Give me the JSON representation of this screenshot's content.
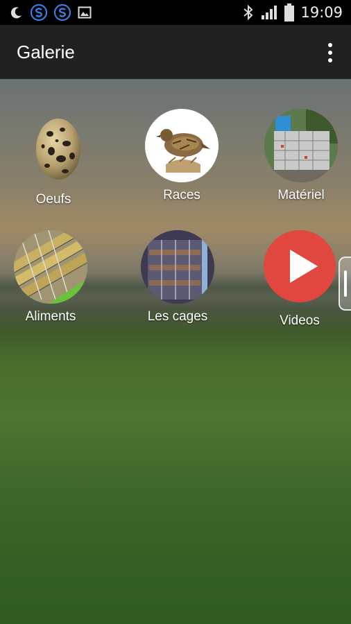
{
  "status_bar": {
    "time": "19:09",
    "icons": [
      "moon-icon",
      "s-app-icon",
      "s-app-icon",
      "image-icon",
      "bluetooth-icon",
      "signal-icon",
      "battery-icon"
    ]
  },
  "app_bar": {
    "title": "Galerie"
  },
  "tiles": [
    {
      "label": "Oeufs"
    },
    {
      "label": "Races"
    },
    {
      "label": "Matériel"
    },
    {
      "label": "Aliments"
    },
    {
      "label": "Les cages"
    },
    {
      "label": "Videos"
    }
  ],
  "colors": {
    "app_bar": "#212121",
    "status_bar": "#000000",
    "video_red": "#e0483f"
  }
}
